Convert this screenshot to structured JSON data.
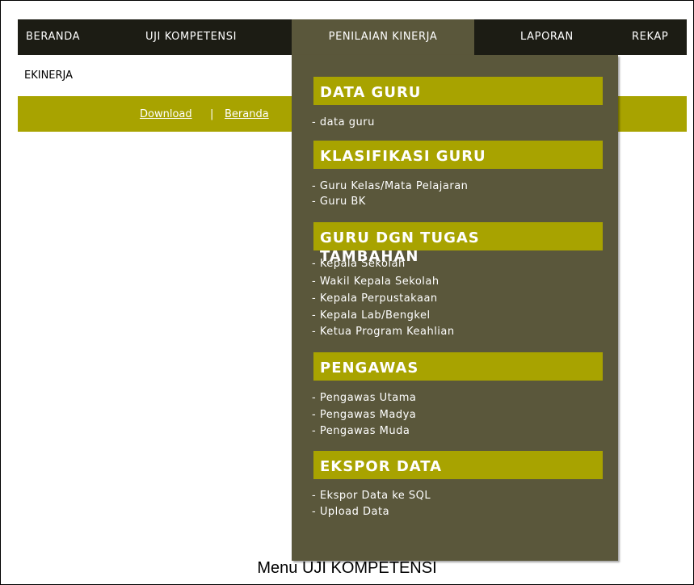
{
  "nav": {
    "items": [
      {
        "label": "BERANDA"
      },
      {
        "label": "UJI KOMPETENSI"
      },
      {
        "label": "PENILAIAN KINERJA"
      },
      {
        "label": "LAPORAN"
      },
      {
        "label": "REKAP"
      }
    ],
    "active_index": 2
  },
  "brand": "EKINERJA",
  "subbar": {
    "download": "Download",
    "separator": "|",
    "home": "Beranda"
  },
  "dropdown": {
    "sections": [
      {
        "title": "DATA GURU",
        "items": [
          "- data guru"
        ]
      },
      {
        "title": "KLASIFIKASI GURU",
        "items": [
          "- Guru Kelas/Mata Pelajaran",
          "- Guru BK"
        ]
      },
      {
        "title_line1": "GURU DGN TUGAS",
        "title_line2": "TAMBAHAN",
        "items": [
          "- Kepala Sekolah",
          "- Wakil Kepala Sekolah",
          "- Kepala Perpustakaan",
          "- Kepala Lab/Bengkel",
          "- Ketua Program Keahlian"
        ]
      },
      {
        "title": "PENGAWAS",
        "items": [
          "- Pengawas Utama",
          "- Pengawas Madya",
          "- Pengawas Muda"
        ]
      },
      {
        "title": "EKSPOR DATA",
        "items": [
          "- Ekspor Data ke SQL",
          "- Upload Data"
        ]
      }
    ]
  },
  "caption": "Menu UJI KOMPETENSI",
  "colors": {
    "nav_bg": "#1c1c14",
    "dropdown_bg": "#5a573b",
    "accent": "#a8a300"
  }
}
